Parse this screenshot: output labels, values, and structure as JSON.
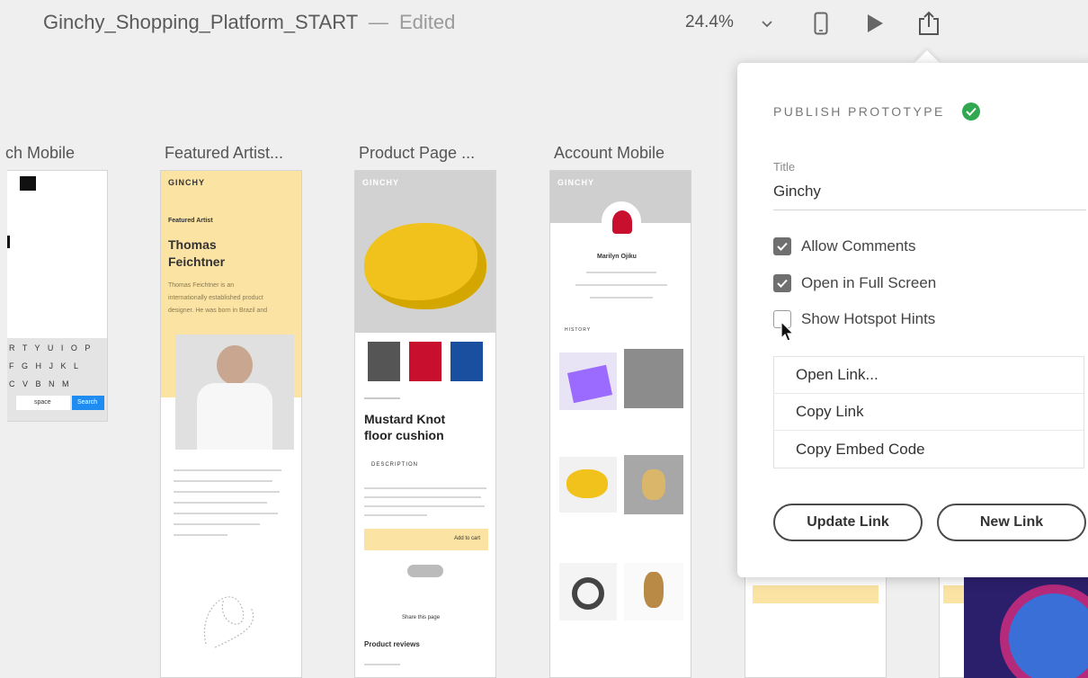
{
  "titlebar": {
    "doc_name": "Ginchy_Shopping_Platform_START",
    "separator": "—",
    "status": "Edited",
    "zoom": "24.4%",
    "icons": [
      "chevron-down-icon",
      "device-preview-icon",
      "play-icon",
      "share-icon"
    ]
  },
  "artboards": [
    {
      "label": "ch Mobile",
      "keyboard_rows": [
        "R T Y U I O P",
        "F G H J K L",
        "C V B N M"
      ],
      "space_label": "space",
      "search_label": "Search"
    },
    {
      "label": "Featured Artist...",
      "brand": "GINCHY",
      "eyebrow": "Featured Artist",
      "name_line1": "Thomas",
      "name_line2": "Feichtner",
      "bio1": "Thomas Feichtner is an",
      "bio2": "internationally established product",
      "bio3": "designer. He was born in Brazil and"
    },
    {
      "label": "Product Page ...",
      "brand": "GINCHY",
      "product_line1": "Mustard Knot",
      "product_line2": "floor cushion",
      "description_label": "DESCRIPTION",
      "add_to_cart": "Add to cart",
      "share": "Share this page",
      "reviews": "Product reviews"
    },
    {
      "label": "Account Mobile",
      "brand": "GINCHY",
      "user_name": "Marilyn Ojiku",
      "history": "HISTORY"
    }
  ],
  "publish_panel": {
    "heading": "PUBLISH PROTOTYPE",
    "title_label": "Title",
    "title_value": "Ginchy",
    "options": [
      {
        "label": "Allow Comments",
        "checked": true
      },
      {
        "label": "Open in Full Screen",
        "checked": true
      },
      {
        "label": "Show Hotspot Hints",
        "checked": false
      }
    ],
    "menu": [
      "Open Link...",
      "Copy Link",
      "Copy Embed Code"
    ],
    "update_button": "Update Link",
    "new_button": "New Link"
  },
  "colors": {
    "background": "#efefef",
    "highlight_yellow": "#fbe3a3",
    "success_green": "#2fa84f",
    "keyboard_blue": "#1e8cf0"
  }
}
